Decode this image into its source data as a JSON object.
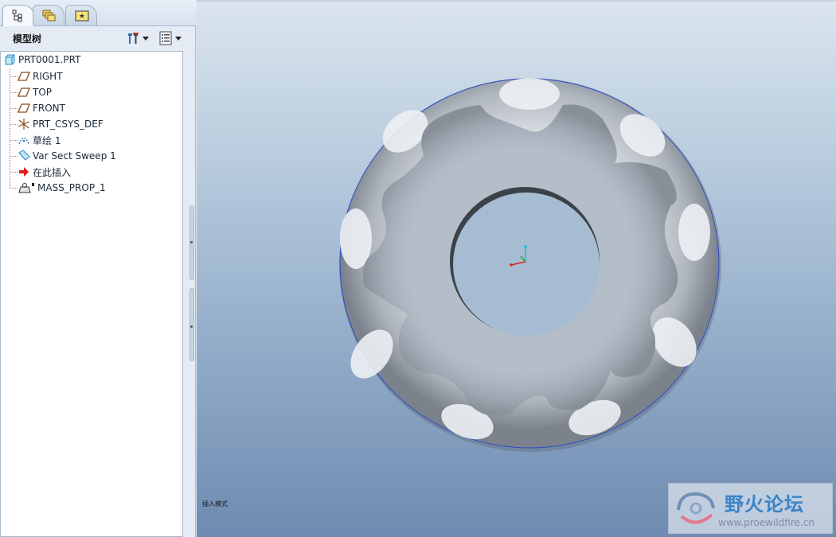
{
  "panel": {
    "tabs": [
      {
        "name": "model-tree-tab",
        "icon": "tree-icon",
        "active": true
      },
      {
        "name": "layers-tab",
        "icon": "layers-icon",
        "active": false
      },
      {
        "name": "folder-browser-tab",
        "icon": "folder-icon",
        "active": false
      }
    ],
    "title": "模型树"
  },
  "tree": {
    "root": "PRT0001.PRT",
    "items": [
      {
        "label": "RIGHT",
        "icon": "datum-plane-icon"
      },
      {
        "label": "TOP",
        "icon": "datum-plane-icon"
      },
      {
        "label": "FRONT",
        "icon": "datum-plane-icon"
      },
      {
        "label": "PRT_CSYS_DEF",
        "icon": "coordinate-system-icon"
      },
      {
        "label": "草绘 1",
        "icon": "sketch-icon"
      },
      {
        "label": "Var Sect Sweep 1",
        "icon": "sweep-feature-icon"
      },
      {
        "label": "在此插入",
        "icon": "insert-here-arrow-icon"
      },
      {
        "label": "MASS_PROP_1",
        "icon": "mass-properties-icon"
      }
    ]
  },
  "viewport": {
    "status_label": "插入模式"
  },
  "watermark": {
    "title": "野火论坛",
    "url": "www.proewildfire.cn"
  }
}
